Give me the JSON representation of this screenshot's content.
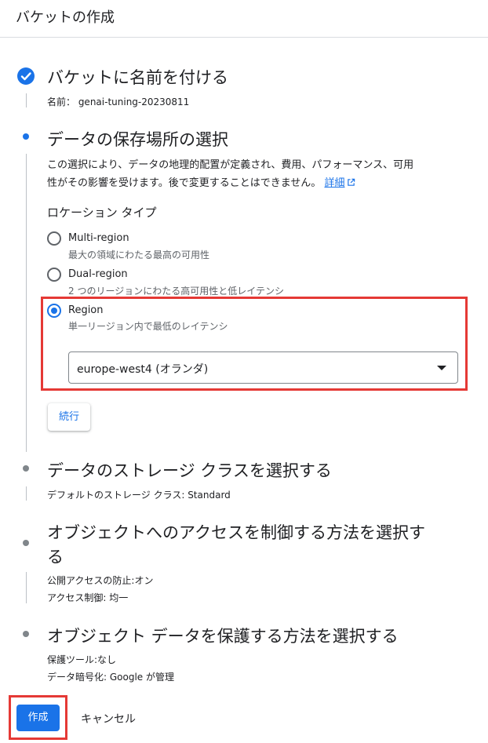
{
  "header": {
    "title": "バケットの作成"
  },
  "steps": {
    "name": {
      "title": "バケットに名前を付ける",
      "summary": "名前：  genai-tuning-20230811",
      "status_icon": "check-circle-icon"
    },
    "location": {
      "title": "データの保存場所の選択",
      "description_line1": "この選択により、データの地理的配置が定義され、費用、パフォーマンス、可用",
      "description_line2": "性がその影響を受けます。後で変更することはできません。",
      "learn_more_link": "詳細",
      "location_type_label": "ロケーション タイプ",
      "options": [
        {
          "label": "Multi-region",
          "description": "最大の領域にわたる最高の可用性",
          "selected": false
        },
        {
          "label": "Dual-region",
          "description": "2 つのリージョンにわたる高可用性と低レイテンシ",
          "selected": false
        },
        {
          "label": "Region",
          "description": "単一リージョン内で最低のレイテンシ",
          "selected": true
        }
      ],
      "region_select": {
        "value": "europe-west4 (オランダ)"
      },
      "continue_label": "続行"
    },
    "storage_class": {
      "title": "データのストレージ クラスを選択する",
      "summary": "デフォルトのストレージ クラス: Standard"
    },
    "access_control": {
      "title_line1": "オブジェクトへのアクセスを制御する方法を選択す",
      "title_line2": "る",
      "summary_line1": "公開アクセスの防止:オン",
      "summary_line2": "アクセス制御: 均一"
    },
    "protection": {
      "title": "オブジェクト データを保護する方法を選択する",
      "summary_line1": "保護ツール:なし",
      "summary_line2": "データ暗号化: Google が管理"
    }
  },
  "actions": {
    "create_label": "作成",
    "cancel_label": "キャンセル"
  },
  "colors": {
    "accent": "#1a73e8",
    "highlight_border": "#e53935",
    "muted_dot": "#80868b"
  }
}
